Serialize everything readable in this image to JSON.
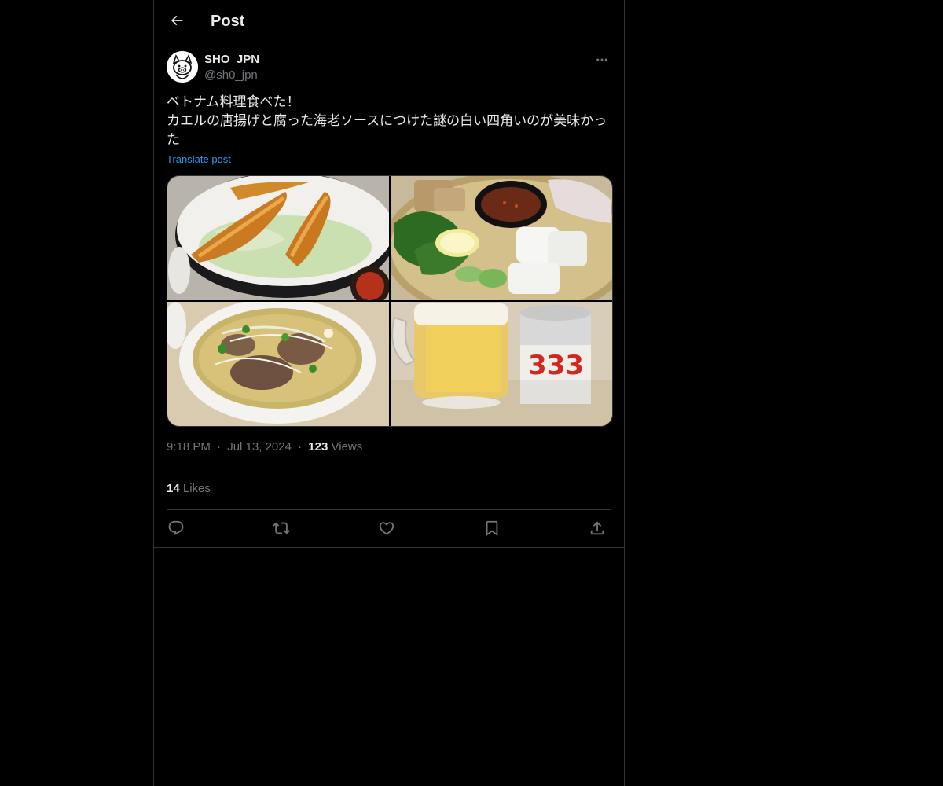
{
  "header": {
    "back_icon": "arrow-left-icon",
    "title": "Post"
  },
  "author": {
    "display_name": "SHO_JPN",
    "handle": "@sh0_jpn",
    "avatar_icon": "cartoon-avatar"
  },
  "post": {
    "lines": [
      "ベトナム料理食べた！",
      "カエルの唐揚げと腐った海老ソースにつけた謎の白い四角いのが美味かった"
    ],
    "translate_label": "Translate post",
    "media": [
      {
        "alt": "fried frog legs on a plate with shredded cabbage"
      },
      {
        "alt": "herbs, lemon, cucumber, rice cakes and shrimp dipping sauce"
      },
      {
        "alt": "bowl of pho noodle soup with beef and green onions"
      },
      {
        "alt": "glass mug of beer next to a 333 beer can"
      }
    ]
  },
  "meta": {
    "time": "9:18 PM",
    "separator": "·",
    "date": "Jul 13, 2024",
    "views_count": "123",
    "views_label": "Views"
  },
  "stats": {
    "likes_count": "14",
    "likes_label": "Likes"
  },
  "actions": {
    "reply_icon": "reply-icon",
    "repost_icon": "repost-icon",
    "like_icon": "heart-icon",
    "bookmark_icon": "bookmark-icon",
    "share_icon": "share-icon"
  },
  "colors": {
    "background": "#000000",
    "text_primary": "#e7e9ea",
    "text_secondary": "#71767b",
    "accent": "#1d9bf0",
    "border": "#2f3336"
  }
}
